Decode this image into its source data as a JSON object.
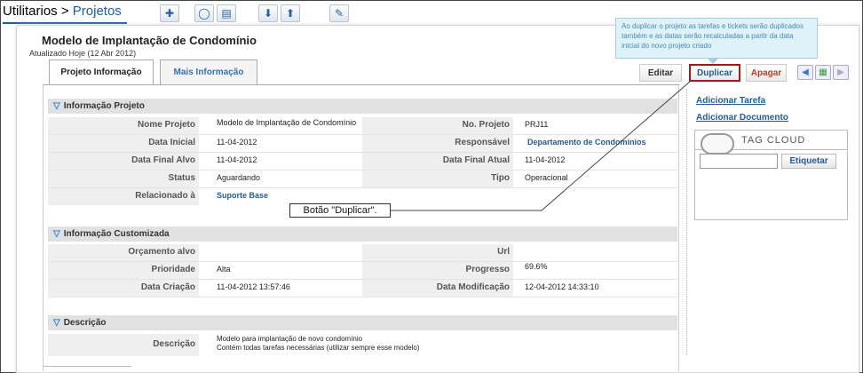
{
  "breadcrumb": {
    "prefix": "Utilitarios > ",
    "current": "Projetos"
  },
  "toolbar": {
    "icons": [
      "add-icon",
      "comment-icon",
      "document-icon",
      "download-icon",
      "upload-icon",
      "tools-icon"
    ],
    "glyphs": [
      "✚",
      "◯",
      "▤",
      "⬇",
      "⬆",
      "✎"
    ]
  },
  "page": {
    "title": "Modelo de Implantação de Condomínio",
    "updated": "Atualizado Hoje (12 Abr 2012)"
  },
  "tabs": [
    {
      "label": "Projeto Informação"
    },
    {
      "label": "Mais Informação"
    }
  ],
  "actions": {
    "edit": "Editar",
    "duplicate": "Duplicar",
    "delete": "Apagar"
  },
  "tooltip": {
    "text": "Ao duplicar o projeto as tarefas e tickets serão duplicados também e as datas serão recalculadas a partir da data inicial do novo projeto criado"
  },
  "callout": {
    "text": "Botão \"Duplicar\"."
  },
  "sections": {
    "info": {
      "title": "Informação Projeto",
      "rows": [
        {
          "l1": "Nome Projeto",
          "v1": "Modelo de Implantação de Condomínio",
          "l2": "No. Projeto",
          "v2": "PRJ11"
        },
        {
          "l1": "Data Inicial",
          "v1": "11-04-2012",
          "l2": "Responsável",
          "v2": "Departamento de Condomínios"
        },
        {
          "l1": "Data Final Alvo",
          "v1": "11-04-2012",
          "l2": "Data Final Atual",
          "v2": "11-04-2012"
        },
        {
          "l1": "Status",
          "v1": "Aguardando",
          "l2": "Tipo",
          "v2": "Operacional"
        },
        {
          "l1": "Relacionado à",
          "v1": "Suporte Base",
          "l2": "",
          "v2": ""
        }
      ]
    },
    "custom": {
      "title": "Informação Customizada",
      "rows": [
        {
          "l1": "Orçamento alvo",
          "v1": "",
          "l2": "Url",
          "v2": ""
        },
        {
          "l1": "Prioridade",
          "v1": "Alta",
          "l2": "Progresso",
          "v2": "69.6%"
        },
        {
          "l1": "Data Criação",
          "v1": "11-04-2012 13:57:46",
          "l2": "Data Modificação",
          "v2": "12-04-2012 14:33:10"
        }
      ]
    },
    "desc": {
      "title": "Descrição",
      "label": "Descrição",
      "line1": "Modelo para implantação de novo condomínio",
      "line2": "Contém todas tarefas necessárias (utilizar sempre esse modelo)"
    }
  },
  "sidebar": {
    "add_task": "Adicionar Tarefa",
    "add_doc": "Adicionar Documento",
    "tag_cloud": "TAG CLOUD",
    "tag_button": "Etiquetar"
  }
}
